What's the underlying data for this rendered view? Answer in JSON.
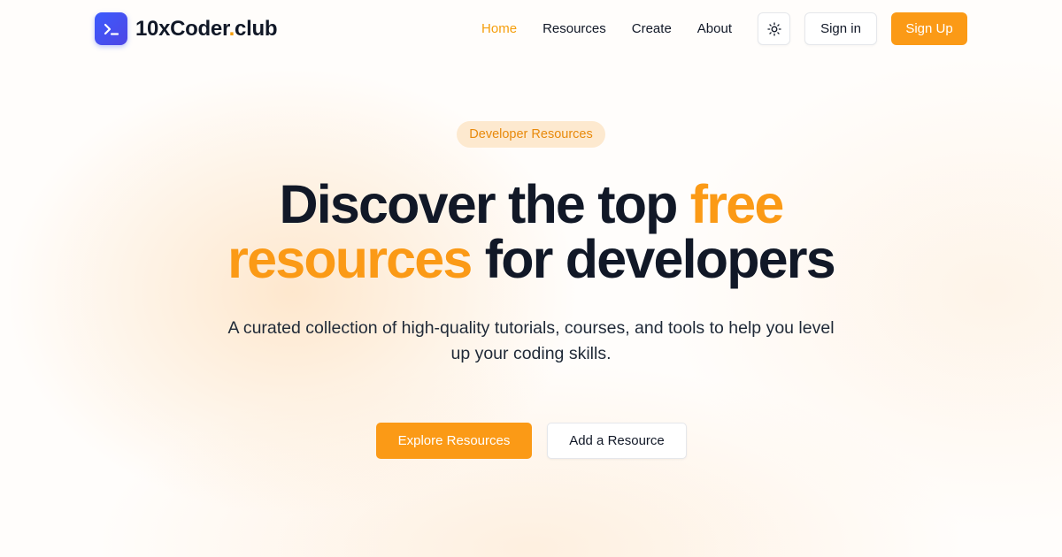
{
  "brand": {
    "name_main": "10xCoder",
    "name_dot": ".",
    "name_tld": "club",
    "logo_icon": "terminal-prompt-icon",
    "accent_color": "#fb9a16",
    "logo_color": "#3b5bfd"
  },
  "nav": {
    "links": [
      {
        "label": "Home",
        "active": true
      },
      {
        "label": "Resources",
        "active": false
      },
      {
        "label": "Create",
        "active": false
      },
      {
        "label": "About",
        "active": false
      }
    ],
    "theme_toggle_icon": "sun-icon",
    "sign_in_label": "Sign in",
    "sign_up_label": "Sign Up"
  },
  "hero": {
    "badge": "Developer Resources",
    "headline_part1": "Discover the top ",
    "headline_accent1": "free",
    "headline_accent2": "resources",
    "headline_part2": " for developers",
    "subtext": "A curated collection of high-quality tutorials, courses, and tools to help you level up your coding skills.",
    "primary_cta": "Explore Resources",
    "secondary_cta": "Add a Resource"
  }
}
